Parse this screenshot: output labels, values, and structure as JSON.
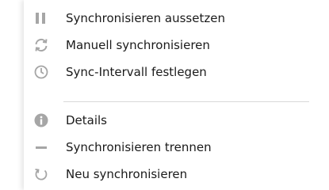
{
  "menu": {
    "items": [
      {
        "label": "Synchronisieren aussetzen",
        "icon": "pause-icon"
      },
      {
        "label": "Manuell synchronisieren",
        "icon": "sync-icon"
      },
      {
        "label": "Sync-Intervall festlegen",
        "icon": "clock-icon"
      },
      {
        "label": "Details",
        "icon": "info-icon"
      },
      {
        "label": "Synchronisieren trennen",
        "icon": "minus-icon"
      },
      {
        "label": "Neu synchronisieren",
        "icon": "refresh-icon"
      }
    ]
  },
  "colors": {
    "icon": "#a6a6a6",
    "text": "#1a1a1a",
    "separator": "#d9d9d9",
    "background": "#ffffff"
  }
}
